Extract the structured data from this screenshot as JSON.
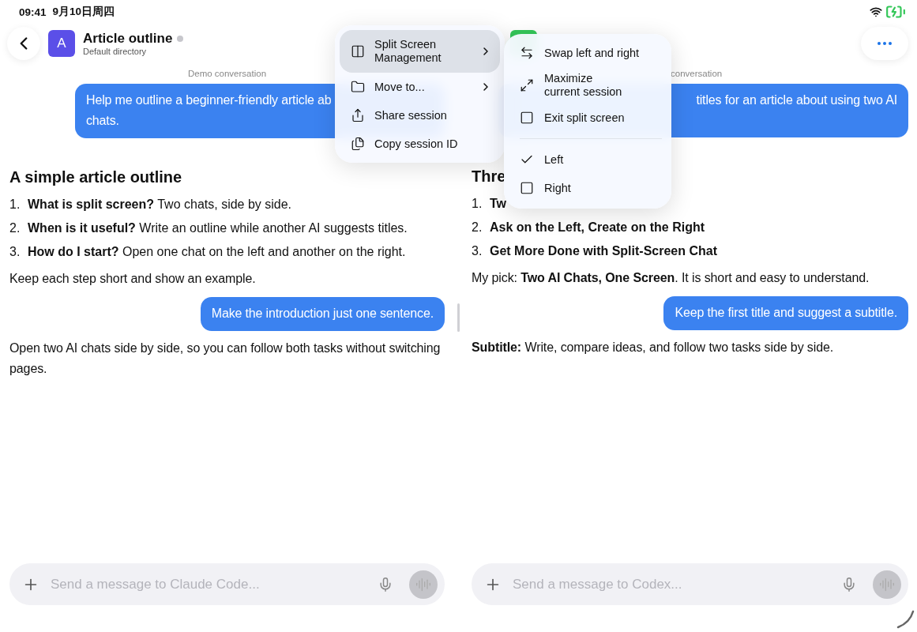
{
  "status_bar": {
    "time": "09:41",
    "date": "9月10日周四"
  },
  "panes": [
    {
      "header": {
        "back_button": true,
        "avatar": "A",
        "title": "Article outline",
        "subtitle": "Default directory"
      },
      "messages": [
        {
          "kind": "caption",
          "text": "Demo conversation"
        },
        {
          "kind": "user",
          "wide": true,
          "lines": [
            "Help me outline a beginner-friendly article ab",
            "chats."
          ]
        },
        {
          "kind": "heading",
          "text": "A simple article outline"
        },
        {
          "kind": "list",
          "items": [
            {
              "number": "1.",
              "text": "**What is split screen?** Two chats, side by side."
            },
            {
              "number": "2.",
              "text": "**When is it useful?** Write an outline while another AI suggests titles."
            },
            {
              "number": "3.",
              "text": "**How do I start?** Open one chat on the left and another on the right."
            }
          ]
        },
        {
          "kind": "paragraph",
          "text": "Keep each step short and show an example."
        },
        {
          "kind": "user",
          "lines": [
            "Make the introduction just one sentence."
          ]
        },
        {
          "kind": "paragraph",
          "text": "Open two AI chats side by side, so you can follow both tasks without switching pages."
        }
      ],
      "input": {
        "placeholder": "Send a message to Claude Code..."
      }
    },
    {
      "header": {
        "more_button": true
      },
      "messages": [
        {
          "kind": "caption",
          "text": "conversation"
        },
        {
          "kind": "user",
          "wide": true,
          "lines": [
            "titles for an article about using two AI"
          ]
        },
        {
          "kind": "heading",
          "text": "Thre"
        },
        {
          "kind": "list",
          "items": [
            {
              "number": "1.",
              "text": "**Tw**"
            },
            {
              "number": "2.",
              "text": "**Ask on the Left, Create on the Right**"
            },
            {
              "number": "3.",
              "text": "**Get More Done with Split-Screen Chat**"
            }
          ]
        },
        {
          "kind": "paragraph",
          "text": "My pick: **Two AI Chats, One Screen**. It is short and easy to understand."
        },
        {
          "kind": "user",
          "lines": [
            "Keep the first title and suggest a subtitle."
          ]
        },
        {
          "kind": "paragraph",
          "text": "**Subtitle:** Write, compare ideas, and follow two tasks side by side."
        }
      ],
      "input": {
        "placeholder": "Send a message to Codex..."
      }
    }
  ],
  "menu": {
    "items": [
      {
        "label": "Split Screen Management",
        "selected": true,
        "submenu": true
      },
      {
        "label": "Move to...",
        "selected": false,
        "submenu": true
      },
      {
        "label": "Share session",
        "selected": false,
        "submenu": false
      },
      {
        "label": "Copy session ID",
        "selected": false,
        "submenu": false
      }
    ]
  },
  "submenu": {
    "items": [
      {
        "kind": "action",
        "label": "Swap left and right"
      },
      {
        "kind": "action",
        "label": "Maximize\ncurrent session"
      },
      {
        "kind": "action",
        "label": "Exit split screen"
      },
      {
        "kind": "divider"
      },
      {
        "kind": "option",
        "label": "Left",
        "checked": true
      },
      {
        "kind": "option",
        "label": "Right",
        "checked": false
      }
    ]
  }
}
